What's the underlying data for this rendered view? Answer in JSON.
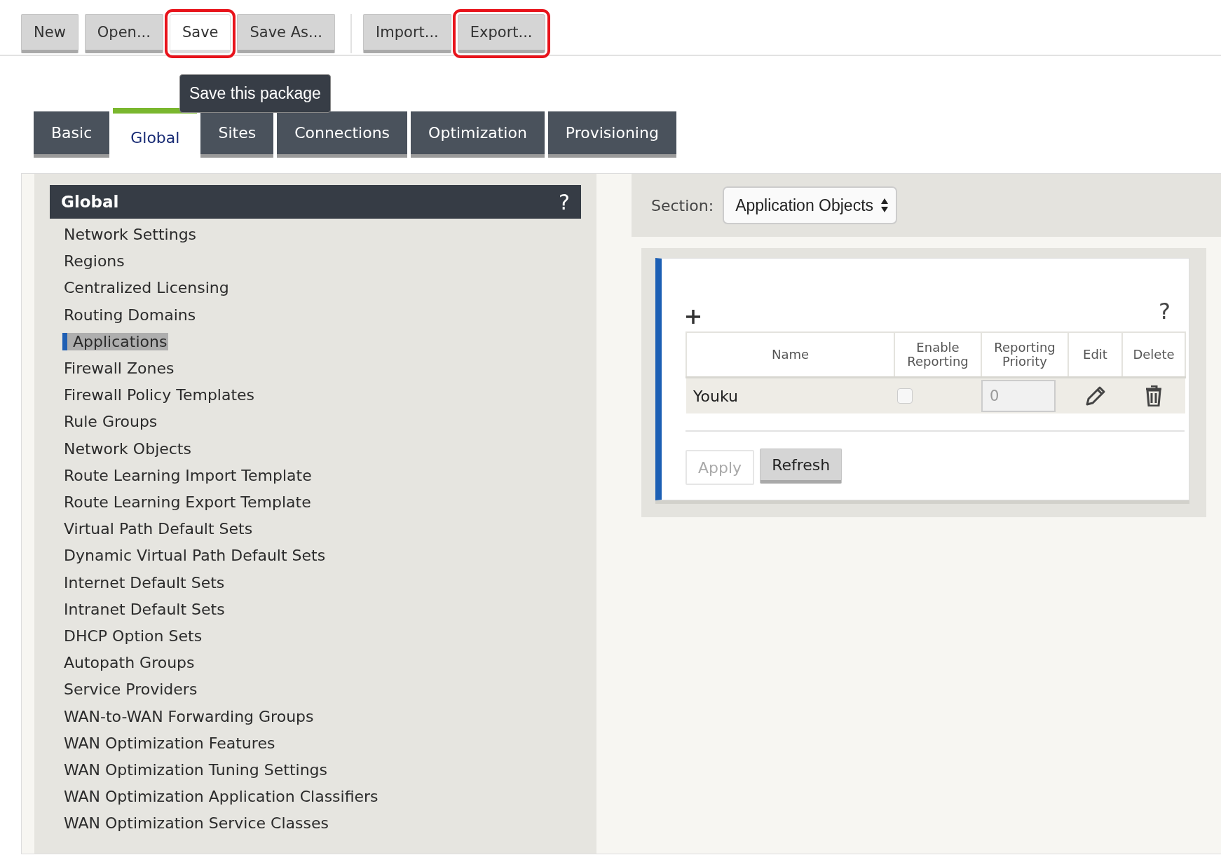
{
  "toolbar": {
    "groups": [
      {
        "buttons": [
          {
            "label": "New",
            "hovered": false,
            "highlighted": false
          },
          {
            "label": "Open...",
            "hovered": false,
            "highlighted": false
          },
          {
            "label": "Save",
            "hovered": true,
            "highlighted": true
          },
          {
            "label": "Save As...",
            "hovered": false,
            "highlighted": false
          }
        ]
      },
      {
        "buttons": [
          {
            "label": "Import...",
            "hovered": false,
            "highlighted": false
          },
          {
            "label": "Export...",
            "hovered": false,
            "highlighted": true
          }
        ]
      }
    ],
    "tooltip": "Save this package"
  },
  "tabs": [
    {
      "label": "Basic",
      "selected": false
    },
    {
      "label": "Global",
      "selected": true
    },
    {
      "label": "Sites",
      "selected": false
    },
    {
      "label": "Connections",
      "selected": false
    },
    {
      "label": "Optimization",
      "selected": false
    },
    {
      "label": "Provisioning",
      "selected": false
    }
  ],
  "sidebar": {
    "title": "Global",
    "help": "?",
    "items": [
      {
        "label": "Network Settings",
        "selected": false
      },
      {
        "label": "Regions",
        "selected": false
      },
      {
        "label": "Centralized Licensing",
        "selected": false
      },
      {
        "label": "Routing Domains",
        "selected": false
      },
      {
        "label": "Applications",
        "selected": true
      },
      {
        "label": "Firewall Zones",
        "selected": false
      },
      {
        "label": "Firewall Policy Templates",
        "selected": false
      },
      {
        "label": "Rule Groups",
        "selected": false
      },
      {
        "label": "Network Objects",
        "selected": false
      },
      {
        "label": "Route Learning Import Template",
        "selected": false
      },
      {
        "label": "Route Learning Export Template",
        "selected": false
      },
      {
        "label": "Virtual Path Default Sets",
        "selected": false
      },
      {
        "label": "Dynamic Virtual Path Default Sets",
        "selected": false
      },
      {
        "label": "Internet Default Sets",
        "selected": false
      },
      {
        "label": "Intranet Default Sets",
        "selected": false
      },
      {
        "label": "DHCP Option Sets",
        "selected": false
      },
      {
        "label": "Autopath Groups",
        "selected": false
      },
      {
        "label": "Service Providers",
        "selected": false
      },
      {
        "label": "WAN-to-WAN Forwarding Groups",
        "selected": false
      },
      {
        "label": "WAN Optimization Features",
        "selected": false
      },
      {
        "label": "WAN Optimization Tuning Settings",
        "selected": false
      },
      {
        "label": "WAN Optimization Application Classifiers",
        "selected": false
      },
      {
        "label": "WAN Optimization Service Classes",
        "selected": false
      }
    ]
  },
  "section": {
    "label": "Section:",
    "value": "Application Objects"
  },
  "card": {
    "help": "?",
    "columns": [
      "Name",
      "Enable Reporting",
      "Reporting Priority",
      "Edit",
      "Delete"
    ],
    "rows": [
      {
        "name": "Youku",
        "enable_reporting": false,
        "priority": "0"
      }
    ],
    "buttons": [
      {
        "label": "Apply",
        "disabled": true
      },
      {
        "label": "Refresh",
        "disabled": false
      }
    ]
  }
}
